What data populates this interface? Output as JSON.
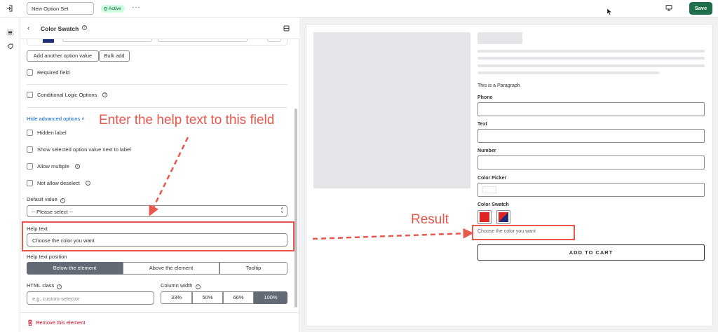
{
  "topbar": {
    "title_value": "New Option Set",
    "status": "Active",
    "more_label": "···",
    "save_label": "Save"
  },
  "panel": {
    "title": "Color Swatch",
    "add_option_label": "Add another option value",
    "bulk_add_label": "Bulk add",
    "required_label": "Required field",
    "conditional_label": "Conditional Logic Options",
    "hide_advanced_label": "Hide advanced options",
    "hidden_label": "Hidden label",
    "show_selected_label": "Show selected option value next to label",
    "allow_multiple_label": "Allow multiple",
    "not_allow_deselect_label": "Not allow deselect",
    "default_value_label": "Default value",
    "default_value_selected": "-- Please select --",
    "help_text_label": "Help text",
    "help_text_value": "Choose the color you want",
    "help_position_label": "Help text position",
    "help_position_options": [
      "Below the element",
      "Above the element",
      "Tooltip"
    ],
    "help_position_selected": "Below the element",
    "html_class_label": "HTML class",
    "html_class_placeholder": "e.g. custom-selector",
    "column_width_label": "Column width",
    "column_width_options": [
      "33%",
      "50%",
      "66%",
      "100%"
    ],
    "column_width_selected": "100%",
    "remove_label": "Remove this element"
  },
  "preview": {
    "paragraph": "This is a Paragraph",
    "fields": [
      "Phone",
      "Text",
      "Number",
      "Color Picker"
    ],
    "swatch_label": "Color Swatch",
    "swatch_colors": [
      "#e02424",
      "#1e2a78"
    ],
    "help_text": "Choose the color you want",
    "add_to_cart": "ADD TO CART"
  },
  "annotations": {
    "field_note": "Enter the help text to this field",
    "result_note": "Result",
    "color": "#e8584c"
  },
  "colors": {
    "save_bg": "#1e6e4c",
    "segment_active": "#616a75",
    "link": "#005bd3",
    "danger": "#c70a24"
  }
}
